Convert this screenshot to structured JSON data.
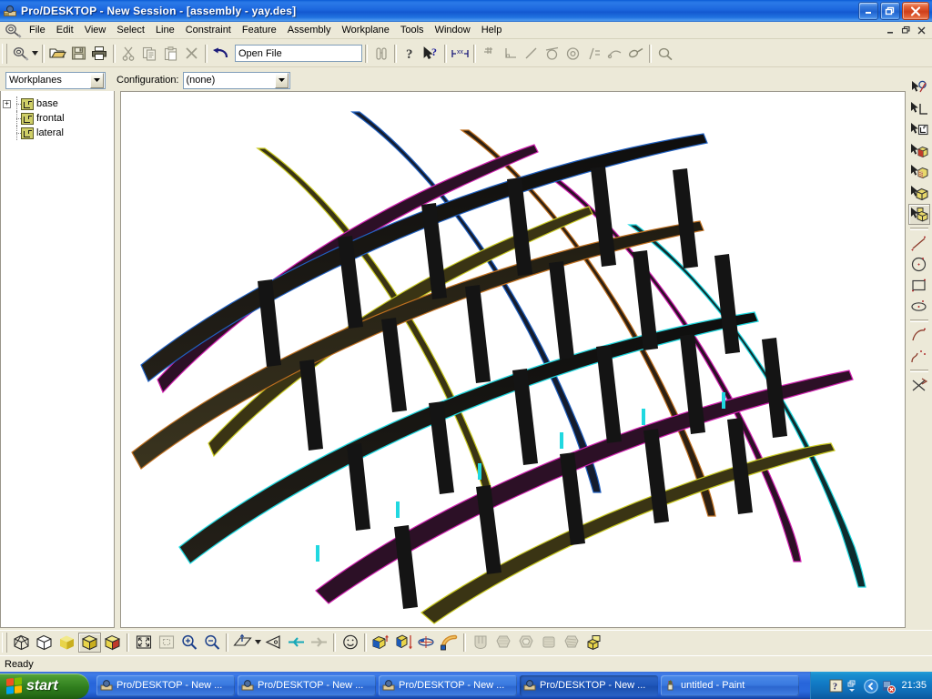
{
  "window": {
    "title": "Pro/DESKTOP - New Session - [assembly - yay.des]",
    "app_icon": "prodesktop-icon",
    "minimize_label": "_",
    "restore_label": "❐",
    "close_label": "✕"
  },
  "menubar": {
    "logo_icon": "prodesktop-logo-icon",
    "items": [
      {
        "label": "File"
      },
      {
        "label": "Edit"
      },
      {
        "label": "View"
      },
      {
        "label": "Select"
      },
      {
        "label": "Line"
      },
      {
        "label": "Constraint"
      },
      {
        "label": "Feature"
      },
      {
        "label": "Assembly"
      },
      {
        "label": "Workplane"
      },
      {
        "label": "Tools"
      },
      {
        "label": "Window"
      },
      {
        "label": "Help"
      }
    ],
    "mdi_buttons": [
      {
        "icon": "mdi-minimize-icon",
        "label": "_"
      },
      {
        "icon": "mdi-restore-icon",
        "label": "❐"
      },
      {
        "icon": "mdi-close-icon",
        "label": "✕"
      }
    ]
  },
  "toolbar": {
    "buttons": [
      {
        "icon": "new-design-icon",
        "label": "New",
        "enabled": true
      },
      {
        "icon": "dropdown-arrow-icon",
        "label": "New dropdown",
        "enabled": true
      },
      {
        "icon": "open-folder-icon",
        "label": "Open",
        "enabled": true
      },
      {
        "icon": "save-disk-icon",
        "label": "Save",
        "enabled": false
      },
      {
        "icon": "printer-icon",
        "label": "Print",
        "enabled": true
      },
      {
        "icon": "cut-scissors-icon",
        "label": "Cut",
        "enabled": false
      },
      {
        "icon": "copy-icon",
        "label": "Copy",
        "enabled": false
      },
      {
        "icon": "paste-clipboard-icon",
        "label": "Paste",
        "enabled": false
      },
      {
        "icon": "delete-x-icon",
        "label": "Delete",
        "enabled": false
      },
      {
        "icon": "undo-arrow-icon",
        "label": "Undo",
        "enabled": true
      }
    ],
    "open_file_field": {
      "value": "Open File",
      "placeholder": "Open File"
    },
    "buttons2": [
      {
        "icon": "binoculars-icon",
        "label": "Find",
        "enabled": false
      },
      {
        "icon": "help-question-icon",
        "label": "Help",
        "enabled": true
      },
      {
        "icon": "context-help-icon",
        "label": "What's This Help",
        "enabled": true
      },
      {
        "icon": "dimension-xx-icon",
        "label": "Dimension",
        "enabled": true
      },
      {
        "icon": "parallel-icon",
        "label": "Parallel constraint",
        "enabled": false
      },
      {
        "icon": "perpendicular-icon",
        "label": "Perpendicular constraint",
        "enabled": false
      },
      {
        "icon": "collinear-icon",
        "label": "Collinear constraint",
        "enabled": false
      },
      {
        "icon": "tangent-icon",
        "label": "Tangent constraint",
        "enabled": false
      },
      {
        "icon": "concentric-icon",
        "label": "Concentric constraint",
        "enabled": false
      },
      {
        "icon": "equal-length-icon",
        "label": "Equal length constraint",
        "enabled": false
      },
      {
        "icon": "fixed-point-icon",
        "label": "Fix constraint",
        "enabled": false
      },
      {
        "icon": "link-icon",
        "label": "Link constraint",
        "enabled": false
      },
      {
        "icon": "inspect-magnifier-icon",
        "label": "Inspect",
        "enabled": false
      }
    ]
  },
  "browser_bar": {
    "browser_select": {
      "value": "Workplanes",
      "icon": "dropdown-arrow-icon"
    },
    "configuration_label": "Configuration:",
    "configuration_select": {
      "value": "(none)",
      "icon": "dropdown-arrow-icon"
    }
  },
  "tree": {
    "items": [
      {
        "label": "base",
        "icon": "workplane-icon",
        "expander": "+",
        "has_expander": true
      },
      {
        "label": "frontal",
        "icon": "workplane-icon",
        "expander": "",
        "has_expander": false
      },
      {
        "label": "lateral",
        "icon": "workplane-icon",
        "expander": "",
        "has_expander": false
      }
    ]
  },
  "right_toolbar": {
    "buttons": [
      {
        "icon": "select-point-icon",
        "label": "Select point",
        "pressed": false
      },
      {
        "icon": "select-line-icon",
        "label": "Select line",
        "pressed": false
      },
      {
        "icon": "select-workplane-icon",
        "label": "Select workplane",
        "pressed": false
      },
      {
        "icon": "select-face-icon",
        "label": "Select face",
        "pressed": false
      },
      {
        "icon": "select-shaded-face-icon",
        "label": "Select surface",
        "pressed": false
      },
      {
        "icon": "select-part-icon",
        "label": "Select part",
        "pressed": false
      },
      {
        "icon": "select-assembly-icon",
        "label": "Select assembly",
        "pressed": true
      },
      {
        "icon": "line-tool-icon",
        "label": "Line",
        "pressed": false
      },
      {
        "icon": "circle-tool-icon",
        "label": "Circle",
        "pressed": false
      },
      {
        "icon": "rectangle-tool-icon",
        "label": "Rectangle",
        "pressed": false
      },
      {
        "icon": "ellipse-tool-icon",
        "label": "Ellipse",
        "pressed": false
      },
      {
        "icon": "arc-tool-icon",
        "label": "Arc",
        "pressed": false
      },
      {
        "icon": "spline-tool-icon",
        "label": "Spline",
        "pressed": false
      },
      {
        "icon": "trim-tool-icon",
        "label": "Trim",
        "pressed": false
      }
    ]
  },
  "bottom_toolbar": {
    "buttons": [
      {
        "icon": "wireframe-view-icon",
        "label": "Wireframe",
        "pressed": false,
        "enabled": true
      },
      {
        "icon": "hidden-line-view-icon",
        "label": "Hidden line",
        "pressed": false,
        "enabled": true
      },
      {
        "icon": "shaded-view-icon",
        "label": "Shaded",
        "pressed": false,
        "enabled": true
      },
      {
        "icon": "shaded-edges-view-icon",
        "label": "Shaded with edges",
        "pressed": true,
        "enabled": true
      },
      {
        "icon": "section-view-icon",
        "label": "Section view",
        "pressed": false,
        "enabled": true
      },
      {
        "icon": "zoom-fit-icon",
        "label": "Zoom to fit",
        "pressed": false,
        "enabled": true
      },
      {
        "icon": "zoom-selection-icon",
        "label": "Zoom to selection",
        "pressed": false,
        "enabled": false
      },
      {
        "icon": "zoom-in-icon",
        "label": "Zoom in",
        "pressed": false,
        "enabled": true
      },
      {
        "icon": "zoom-out-icon",
        "label": "Zoom out",
        "pressed": false,
        "enabled": true
      },
      {
        "icon": "view-plane-icon",
        "label": "View onto workplane",
        "pressed": false,
        "enabled": true
      },
      {
        "icon": "dropdown-arrow-icon",
        "label": "View dropdown",
        "pressed": false,
        "enabled": true
      },
      {
        "icon": "view-direction-icon",
        "label": "Viewing direction",
        "pressed": false,
        "enabled": true
      },
      {
        "icon": "previous-view-icon",
        "label": "Previous view",
        "pressed": false,
        "enabled": true
      },
      {
        "icon": "next-view-icon",
        "label": "Next view",
        "pressed": false,
        "enabled": false
      },
      {
        "icon": "smiley-icon",
        "label": "Trackball",
        "pressed": false,
        "enabled": true
      },
      {
        "icon": "extrude-icon",
        "label": "Extrude profile",
        "pressed": false,
        "enabled": true
      },
      {
        "icon": "project-icon",
        "label": "Project profile",
        "pressed": false,
        "enabled": true
      },
      {
        "icon": "revolve-icon",
        "label": "Revolve profile",
        "pressed": false,
        "enabled": true
      },
      {
        "icon": "sweep-icon",
        "label": "Sweep profile",
        "pressed": false,
        "enabled": true
      },
      {
        "icon": "round-edge-icon",
        "label": "Round edges",
        "pressed": false,
        "enabled": false
      },
      {
        "icon": "chamfer-icon",
        "label": "Chamfer edges",
        "pressed": false,
        "enabled": false
      },
      {
        "icon": "shell-icon",
        "label": "Shell solid",
        "pressed": false,
        "enabled": false
      },
      {
        "icon": "draft-icon",
        "label": "Draft faces",
        "pressed": false,
        "enabled": false
      },
      {
        "icon": "thread-icon",
        "label": "Thread",
        "pressed": false,
        "enabled": false
      },
      {
        "icon": "assembly-icon",
        "label": "Assembly",
        "pressed": false,
        "enabled": true
      }
    ]
  },
  "statusbar": {
    "text": "Ready"
  },
  "viewport": {
    "background_color": "#ffffff",
    "model_name": "yay.des lattice assembly",
    "blade_colors": [
      "#d020b0",
      "#c8c820",
      "#2060c0",
      "#c07020",
      "#20d8e0",
      "#9a2090"
    ],
    "shade_dark": "#181818",
    "shade_mid": "#2e2a1f"
  },
  "taskbar": {
    "start_label": "start",
    "start_icon": "windows-flag-icon",
    "tasks": [
      {
        "label": "Pro/DESKTOP - New ...",
        "icon": "prodesktop-icon",
        "active": false
      },
      {
        "label": "Pro/DESKTOP - New ...",
        "icon": "prodesktop-icon",
        "active": false
      },
      {
        "label": "Pro/DESKTOP - New ...",
        "icon": "prodesktop-icon",
        "active": false
      },
      {
        "label": "Pro/DESKTOP - New ...",
        "icon": "prodesktop-icon",
        "active": true
      },
      {
        "label": "untitled - Paint",
        "icon": "paint-icon",
        "active": false
      }
    ],
    "tray": {
      "icons": [
        {
          "icon": "help-tray-icon",
          "label": "?"
        },
        {
          "icon": "show-hidden-chevron-icon",
          "label": "▼"
        },
        {
          "icon": "show-desktop-icon",
          "label": "◀"
        },
        {
          "icon": "security-alert-icon",
          "label": "!"
        }
      ],
      "clock": "21:35"
    }
  }
}
